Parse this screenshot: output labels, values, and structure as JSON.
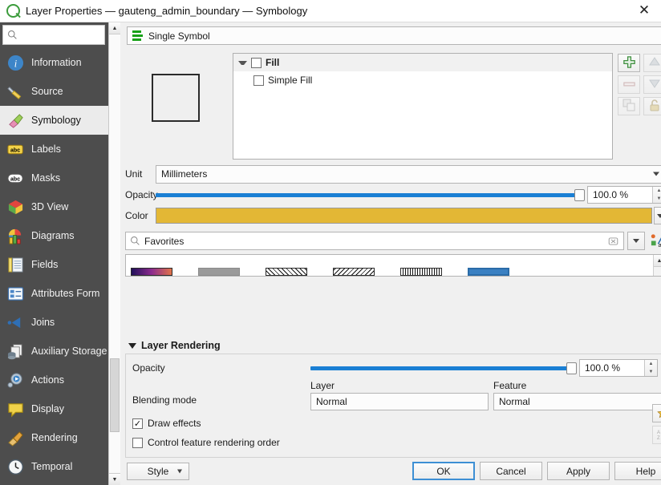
{
  "window": {
    "title": "Layer Properties — gauteng_admin_boundary — Symbology",
    "close_label": "✕",
    "logo_icon": "qgis-logo-icon"
  },
  "sidebar": {
    "search": {
      "value": "",
      "placeholder": ""
    },
    "items": [
      {
        "label": "Information",
        "icon": "information-icon",
        "selected": false
      },
      {
        "label": "Source",
        "icon": "source-icon",
        "selected": false
      },
      {
        "label": "Symbology",
        "icon": "symbology-brush-icon",
        "selected": true
      },
      {
        "label": "Labels",
        "icon": "labels-abc-icon",
        "selected": false
      },
      {
        "label": "Masks",
        "icon": "masks-abc-icon",
        "selected": false
      },
      {
        "label": "3D View",
        "icon": "3d-view-cube-icon",
        "selected": false
      },
      {
        "label": "Diagrams",
        "icon": "diagrams-chart-icon",
        "selected": false
      },
      {
        "label": "Fields",
        "icon": "fields-table-icon",
        "selected": false
      },
      {
        "label": "Attributes Form",
        "icon": "attributes-form-icon",
        "selected": false
      },
      {
        "label": "Joins",
        "icon": "joins-icon",
        "selected": false
      },
      {
        "label": "Auxiliary Storage",
        "icon": "auxiliary-storage-icon",
        "selected": false
      },
      {
        "label": "Actions",
        "icon": "actions-gear-icon",
        "selected": false
      },
      {
        "label": "Display",
        "icon": "display-balloon-icon",
        "selected": false
      },
      {
        "label": "Rendering",
        "icon": "rendering-brush-icon",
        "selected": false
      },
      {
        "label": "Temporal",
        "icon": "temporal-clock-icon",
        "selected": false
      }
    ]
  },
  "renderer": {
    "selected": "Single Symbol",
    "icon": "single-symbol-icon"
  },
  "symbol_tree": {
    "rows": [
      {
        "label": "Fill",
        "level": 0,
        "checked": false,
        "expanded": true
      },
      {
        "label": "Simple Fill",
        "level": 1,
        "checked": false
      }
    ]
  },
  "symbol_tools": [
    {
      "name": "add-symbol-layer-button",
      "icon": "plus-icon",
      "enabled": true
    },
    {
      "name": "move-up-button",
      "icon": "arrow-up-icon",
      "enabled": false
    },
    {
      "name": "remove-symbol-layer-button",
      "icon": "minus-icon",
      "enabled": false
    },
    {
      "name": "move-down-button",
      "icon": "arrow-down-icon",
      "enabled": false
    },
    {
      "name": "duplicate-symbol-layer-button",
      "icon": "duplicate-icon",
      "enabled": false
    },
    {
      "name": "lock-layer-button",
      "icon": "lock-icon",
      "enabled": false
    }
  ],
  "symbol_props": {
    "unit_label": "Unit",
    "unit_value": "Millimeters",
    "opacity_label": "Opacity",
    "opacity_value": "100.0 %",
    "opacity_percent": 100,
    "color_label": "Color",
    "color_value": "#e3b735"
  },
  "favorites": {
    "search_value": "Favorites",
    "placeholder": "Favorites",
    "search_icon": "search-icon",
    "clear_icon": "clear-icon",
    "dropdown_icon": "chevron-down-icon",
    "style_manager_icon": "style-manager-icon",
    "swatches": [
      {
        "name": "gradient-fill-swatch",
        "color": "#7b2d8e"
      },
      {
        "name": "gray-fill-swatch",
        "color": "#9a9a9a"
      },
      {
        "name": "hatch-forward-swatch",
        "color": "#ffffff"
      },
      {
        "name": "hatch-backward-swatch",
        "color": "#ffffff"
      },
      {
        "name": "zigzag-swatch",
        "color": "#ffffff"
      },
      {
        "name": "blue-outline-swatch",
        "color": "#3a80c2"
      }
    ]
  },
  "layer_rendering": {
    "title": "Layer Rendering",
    "opacity_label": "Opacity",
    "opacity_value": "100.0 %",
    "opacity_percent": 100,
    "blending_label": "Blending mode",
    "layer_caption": "Layer",
    "layer_value": "Normal",
    "feature_caption": "Feature",
    "feature_value": "Normal",
    "draw_effects_label": "Draw effects",
    "draw_effects_checked": true,
    "control_order_label": "Control feature rendering order",
    "control_order_checked": false,
    "effects_icon": "star-effects-icon",
    "sort_icon": "sort-order-icon"
  },
  "buttons": {
    "style": "Style",
    "ok": "OK",
    "cancel": "Cancel",
    "apply": "Apply",
    "help": "Help"
  },
  "colors": {
    "accent": "#1a7fd4",
    "sidebar_bg": "#4d4d4d",
    "fill_color": "#e3b735",
    "qgis_green": "#3c9c3c"
  }
}
